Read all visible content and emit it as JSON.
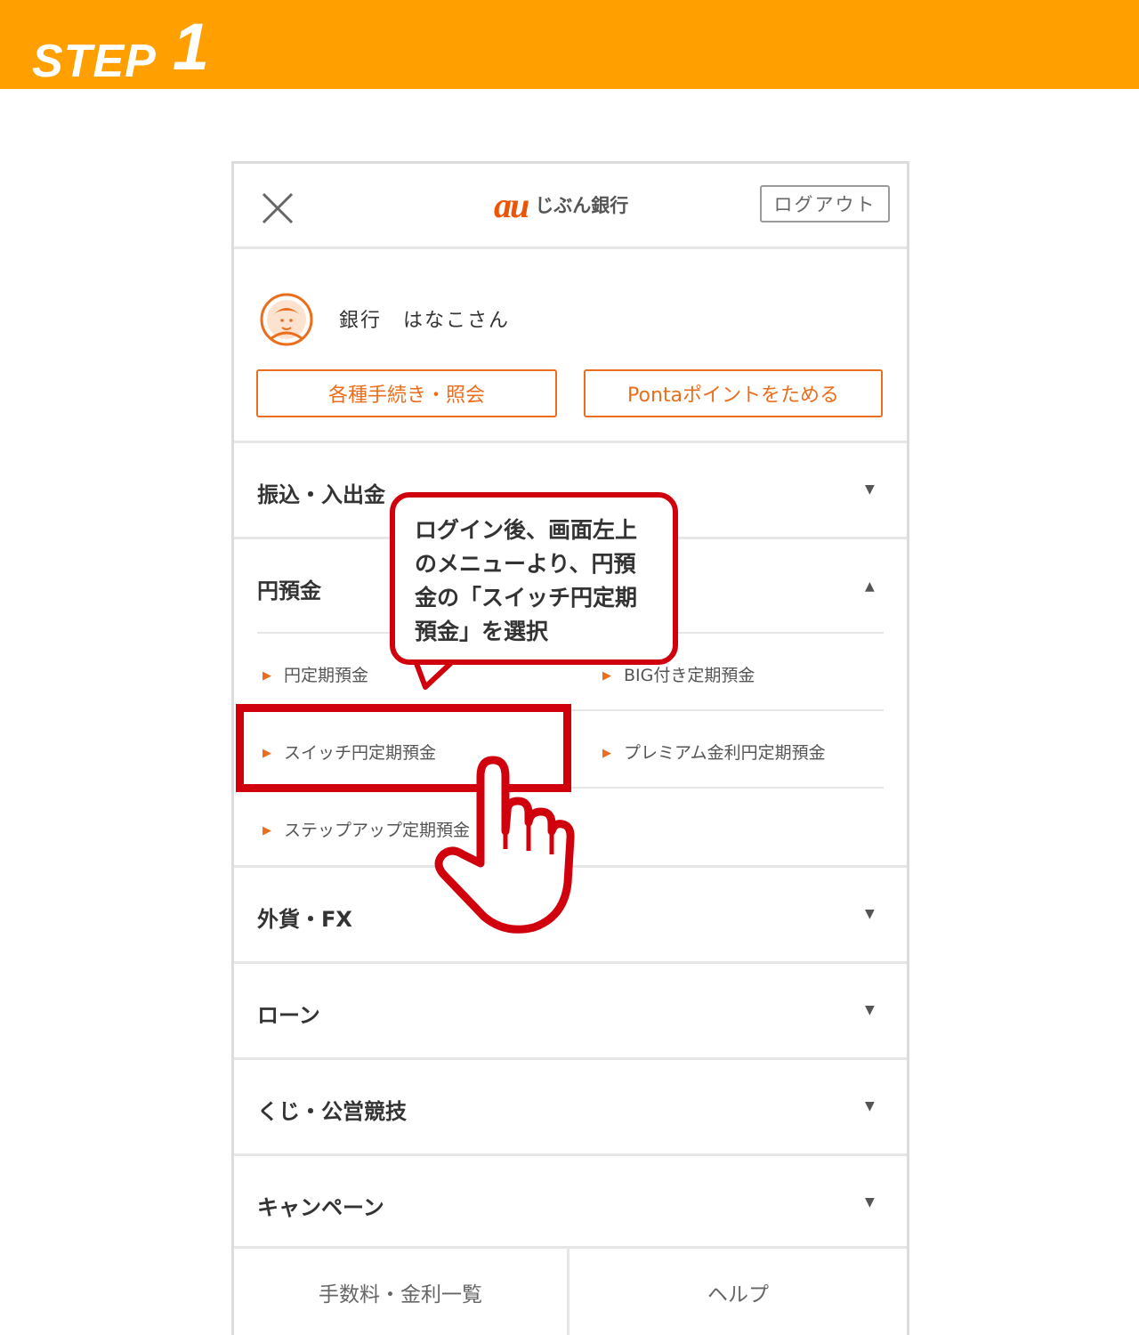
{
  "banner": {
    "step_word": "STEP",
    "step_number": "1",
    "color": "#ff9f00"
  },
  "header": {
    "logo_mark": "au",
    "logo_name": "じぶん銀行",
    "logout_label": "ログアウト",
    "close_icon": "close-icon"
  },
  "profile": {
    "user_name": "銀行　はなこさん",
    "buttons": [
      {
        "label": "各種手続き・照会"
      },
      {
        "label": "Pontaポイントをためる"
      }
    ]
  },
  "menu": [
    {
      "label": "振込・入出金",
      "state": "collapsed"
    },
    {
      "label": "円預金",
      "state": "expanded",
      "items": [
        {
          "label": "円定期預金"
        },
        {
          "label": "BIG付き定期預金"
        },
        {
          "label": "スイッチ円定期預金"
        },
        {
          "label": "プレミアム金利円定期預金"
        },
        {
          "label": "ステップアップ定期預金"
        }
      ]
    },
    {
      "label": "外貨・FX",
      "state": "collapsed"
    },
    {
      "label": "ローン",
      "state": "collapsed"
    },
    {
      "label": "くじ・公営競技",
      "state": "collapsed"
    },
    {
      "label": "キャンペーン",
      "state": "collapsed"
    }
  ],
  "footer": [
    {
      "label": "手数料・金利一覧"
    },
    {
      "label": "ヘルプ"
    }
  ],
  "callout": {
    "lines": [
      "ログイン後、画面左上",
      "のメニューより、円預",
      "金の「スイッチ円定期",
      "預金」を選択"
    ]
  },
  "colors": {
    "accent": "#ec6d1c",
    "highlight": "#d0000c"
  }
}
